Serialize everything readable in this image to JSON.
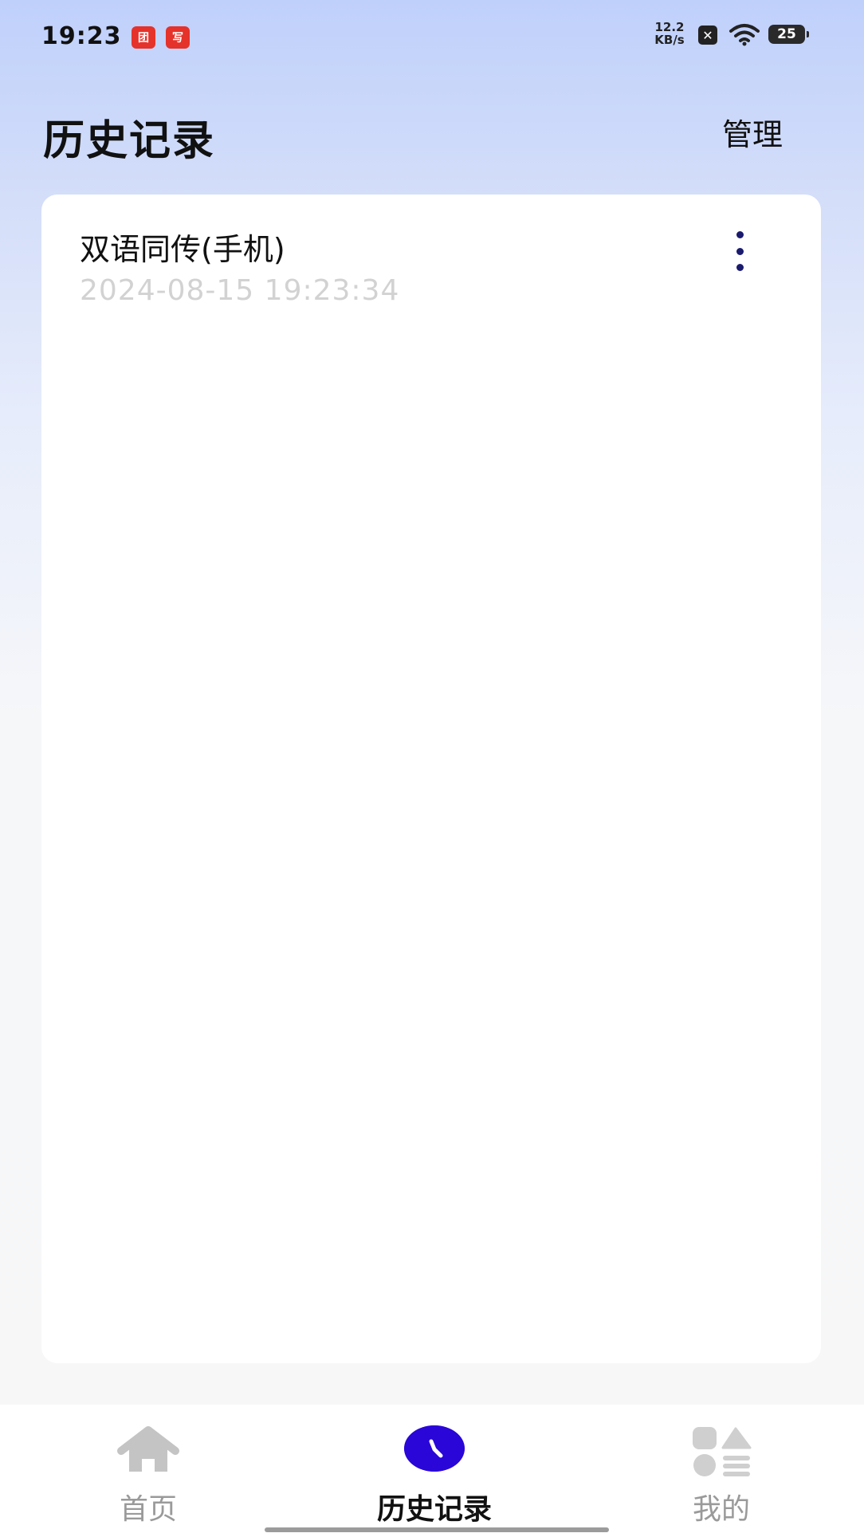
{
  "status_bar": {
    "time": "19:23",
    "app_badges": [
      "团",
      "写"
    ],
    "net_speed_value": "12.2",
    "net_speed_unit": "KB/s",
    "sim_label": "✕",
    "battery_level": "25"
  },
  "header": {
    "title": "历史记录",
    "manage_label": "管理"
  },
  "history": {
    "items": [
      {
        "title": "双语同传(手机)",
        "timestamp": "2024-08-15 19:23:34"
      }
    ]
  },
  "bottom_nav": {
    "items": [
      {
        "label": "首页",
        "icon": "home-icon",
        "active": false
      },
      {
        "label": "历史记录",
        "icon": "clock-icon",
        "active": true
      },
      {
        "label": "我的",
        "icon": "profile-grid-icon",
        "active": false
      }
    ]
  },
  "colors": {
    "accent": "#2a06d8",
    "more_dots": "#1a1a6e",
    "timestamp_text": "#d2d2d2",
    "inactive_nav": "#9a9a9a"
  }
}
